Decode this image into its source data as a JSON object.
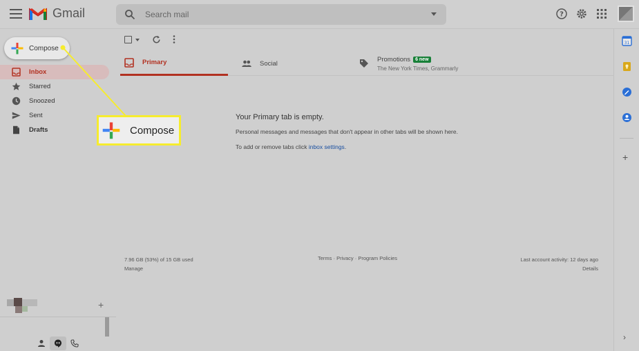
{
  "app": {
    "name": "Gmail"
  },
  "search": {
    "placeholder": "Search mail"
  },
  "compose": {
    "label": "Compose"
  },
  "sidebar": {
    "items": [
      {
        "label": "Inbox",
        "icon": "inbox-icon"
      },
      {
        "label": "Starred",
        "icon": "star-icon"
      },
      {
        "label": "Snoozed",
        "icon": "clock-icon"
      },
      {
        "label": "Sent",
        "icon": "send-icon"
      },
      {
        "label": "Drafts",
        "icon": "draft-icon"
      }
    ]
  },
  "tabs": {
    "primary": "Primary",
    "social": "Social",
    "promotions": "Promotions",
    "promotions_badge": "6 new",
    "promotions_sub": "The New York Times, Grammarly"
  },
  "empty": {
    "title": "Your Primary tab is empty.",
    "line1": "Personal messages and messages that don't appear in other tabs will be shown here.",
    "line2_prefix": "To add or remove tabs click ",
    "line2_link": "inbox settings",
    "line2_suffix": "."
  },
  "footer": {
    "storage": "7.96 GB (53%) of 15 GB used",
    "manage": "Manage",
    "terms": "Terms",
    "sep": " · ",
    "privacy": "Privacy",
    "policies": "Program Policies",
    "activity": "Last account activity: 12 days ago",
    "details": "Details"
  },
  "callout": {
    "label": "Compose"
  },
  "colors": {
    "accent_red": "#b23121",
    "badge_green": "#188038",
    "callout_yellow": "#f6ec2e",
    "link_blue": "#1a4fa0"
  }
}
